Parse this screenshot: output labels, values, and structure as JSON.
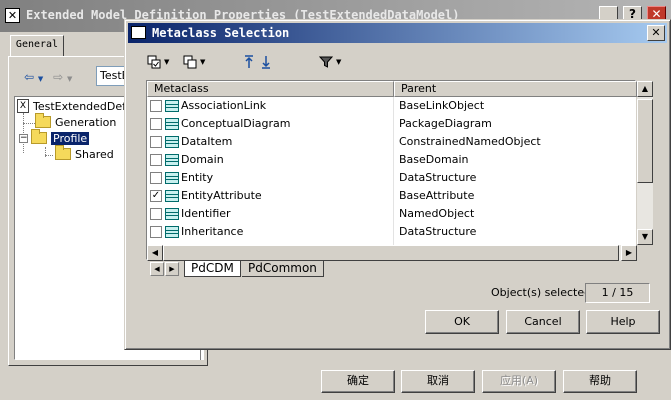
{
  "background_window": {
    "title": "Extended Model Definition Properties (TestExtendedDataModel)",
    "tab_general": "General",
    "combo_value": "TestE",
    "tree": {
      "root": "TestExtendedDefi",
      "items": [
        "Generation",
        "Profile",
        "Shared"
      ]
    },
    "buttons": {
      "ok": "确定",
      "cancel": "取消",
      "apply": "应用(A)",
      "help": "帮助"
    }
  },
  "dialog": {
    "title": "Metaclass Selection",
    "columns": {
      "metaclass": "Metaclass",
      "parent": "Parent"
    },
    "rows": [
      {
        "name": "AssociationLink",
        "parent": "BaseLinkObject",
        "checked": false
      },
      {
        "name": "ConceptualDiagram",
        "parent": "PackageDiagram",
        "checked": false
      },
      {
        "name": "DataItem",
        "parent": "ConstrainedNamedObject",
        "checked": false
      },
      {
        "name": "Domain",
        "parent": "BaseDomain",
        "checked": false
      },
      {
        "name": "Entity",
        "parent": "DataStructure",
        "checked": false
      },
      {
        "name": "EntityAttribute",
        "parent": "BaseAttribute",
        "checked": true
      },
      {
        "name": "Identifier",
        "parent": "NamedObject",
        "checked": false
      },
      {
        "name": "Inheritance",
        "parent": "DataStructure",
        "checked": false
      }
    ],
    "tabs": [
      "PdCDM",
      "PdCommon"
    ],
    "selected_label": "Object(s) selected:",
    "selected_value": "1 / 15",
    "buttons": {
      "ok": "OK",
      "cancel": "Cancel",
      "help": "Help"
    }
  }
}
